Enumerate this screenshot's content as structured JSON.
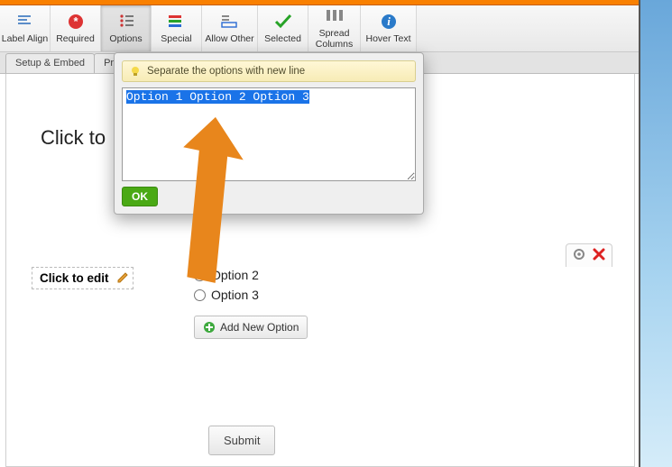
{
  "ribbon": {
    "label_align": "Label Align",
    "required": "Required",
    "options": "Options",
    "special": "Special",
    "allow_other": "Allow Other",
    "selected": "Selected",
    "spread_columns": "Spread\nColumns",
    "hover_text": "Hover Text"
  },
  "tabs": {
    "setup_embed": "Setup & Embed",
    "tab2_partial": "Pro"
  },
  "headline": "Click to",
  "popup": {
    "hint_text": "Separate the options with new line",
    "options_text": "Option 1\nOption 2\nOption 3",
    "ok_label": "OK"
  },
  "question": {
    "label": "Click to edit",
    "options": [
      "Option 2",
      "Option 3"
    ],
    "add_label": "Add New Option"
  },
  "submit_label": "Submit"
}
